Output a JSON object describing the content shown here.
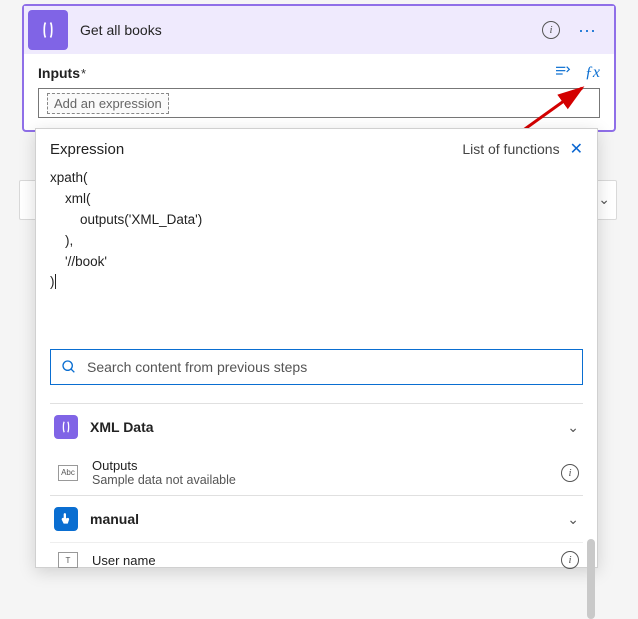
{
  "action": {
    "title": "Get all books"
  },
  "inputs": {
    "label": "Inputs",
    "required_mark": "*",
    "expression_chip": "Add an expression"
  },
  "exprPanel": {
    "title": "Expression",
    "functionsLink": "List of functions",
    "code": "xpath(\n    xml(\n        outputs('XML_Data')\n    ),\n    '//book'\n)"
  },
  "search": {
    "placeholder": "Search content from previous steps"
  },
  "steps": {
    "group_xml": "XML Data",
    "item_outputs": "Outputs",
    "item_outputs_sub": "Sample data not available",
    "group_manual": "manual",
    "item_username": "User name"
  },
  "colors": {
    "accent": "#8064e6",
    "blue": "#0a6ed1"
  }
}
